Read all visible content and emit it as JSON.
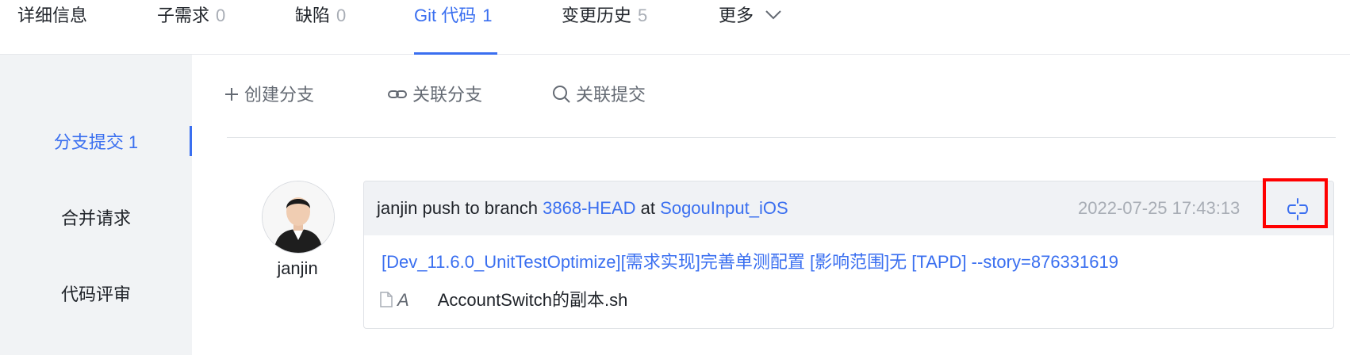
{
  "tabs": [
    {
      "label": "详细信息",
      "count": ""
    },
    {
      "label": "子需求",
      "count": "0"
    },
    {
      "label": "缺陷",
      "count": "0"
    },
    {
      "label": "Git 代码",
      "count": "1",
      "active": true
    },
    {
      "label": "变更历史",
      "count": "5"
    },
    {
      "label": "更多",
      "count": ""
    }
  ],
  "toolbar": {
    "create_branch": "创建分支",
    "link_branch": "关联分支",
    "link_commit": "关联提交"
  },
  "sidebar": {
    "items": [
      {
        "label": "分支提交 1",
        "active": true
      },
      {
        "label": "合并请求"
      },
      {
        "label": "代码评审"
      }
    ]
  },
  "commit": {
    "author": "janjin",
    "action_prefix": "janjin push to branch",
    "branch": "3868-HEAD",
    "at": "at",
    "repo": "SogouInput_iOS",
    "timestamp": "2022-07-25 17:43:13",
    "message": "[Dev_11.6.0_UnitTestOptimize][需求实现]完善单测配置 [影响范围]无 [TAPD] --story=876331619",
    "files": [
      {
        "status": "A",
        "name": "AccountSwitch的副本.sh"
      }
    ]
  },
  "icons": {
    "create": "plus-icon",
    "link": "link-icon",
    "search": "search-icon",
    "unlink": "unlink-icon",
    "file": "file-icon",
    "more": "chevron-down-icon"
  },
  "colors": {
    "accent": "#3a6ff0",
    "muted": "#a8adb5",
    "sidebar_bg": "#f1f3f5",
    "card_head_bg": "#f0f2f5",
    "highlight": "#ff0000"
  }
}
